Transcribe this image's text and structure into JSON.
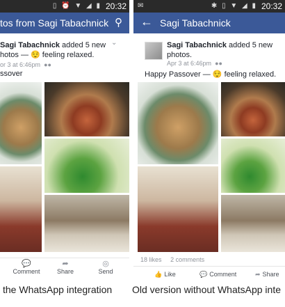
{
  "left": {
    "statusbar": {
      "time": "20:32",
      "icons": "▯ ⏰ ▼ ◢ ▮"
    },
    "appbar": {
      "title": "tos from Sagi Tabachnick"
    },
    "post": {
      "author": "Sagi Tabachnick",
      "action": " added 5 new",
      "action2": "hotos — ",
      "feeling": "😌 feeling relaxed.",
      "date": "or 3 at 6:46pm",
      "caption": "ssover"
    },
    "actions": [
      {
        "icon": "💬",
        "label": "Comment"
      },
      {
        "icon": "➦",
        "label": "Share"
      },
      {
        "icon": "◎",
        "label": "Send"
      }
    ]
  },
  "right": {
    "statusbar": {
      "time": "20:32",
      "icons": "✱ ▯ ▼ ◢ ▮"
    },
    "appbar": {
      "title": "Sagi Tabachnick"
    },
    "post": {
      "author": "Sagi Tabachnick",
      "action": " added 5 new",
      "action2": "photos.",
      "date": "Apr 3 at 6:46pm",
      "caption": "Happy Passover — 😌 feeling relaxed."
    },
    "counts": {
      "likes": "18 likes",
      "comments": "2 comments"
    },
    "actions": [
      {
        "icon": "👍",
        "label": "Like"
      },
      {
        "icon": "💬",
        "label": "Comment"
      },
      {
        "icon": "➦",
        "label": "Share"
      }
    ]
  },
  "captions": {
    "left": "the WhatsApp integration",
    "right": "Old version without WhatsApp inte"
  }
}
